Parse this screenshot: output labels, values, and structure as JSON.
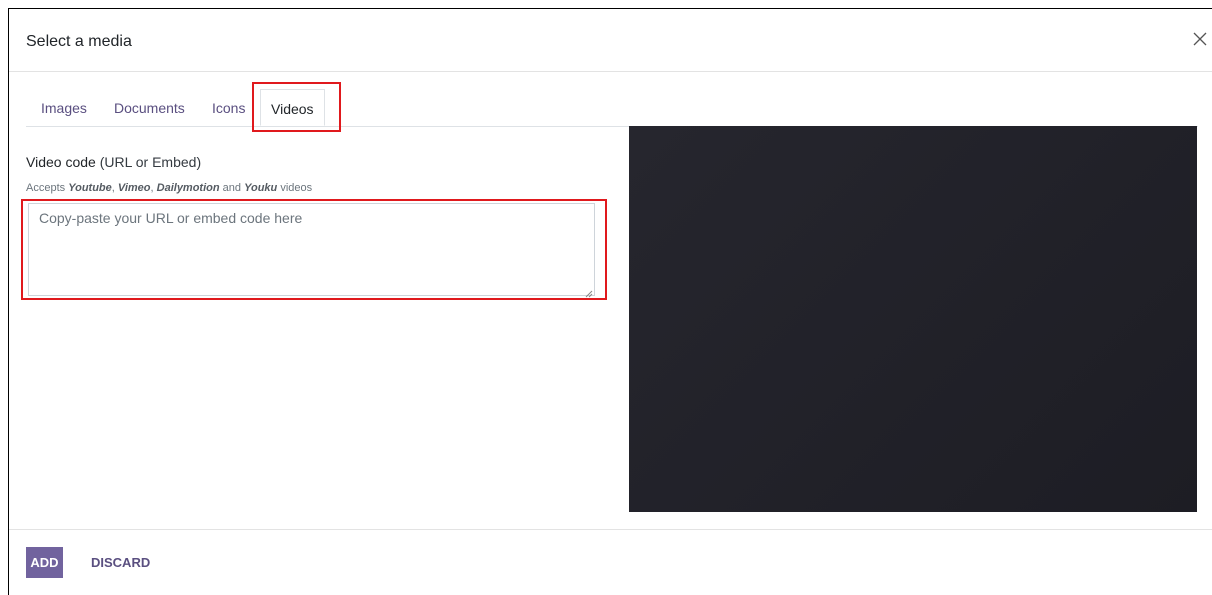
{
  "dialog": {
    "title": "Select a media",
    "close_icon": "close-icon"
  },
  "tabs": [
    {
      "label": "Images",
      "active": false
    },
    {
      "label": "Documents",
      "active": false
    },
    {
      "label": "Icons",
      "active": false
    },
    {
      "label": "Videos",
      "active": true
    }
  ],
  "video_form": {
    "label_main": "Video code",
    "label_sub": "(URL or Embed)",
    "help_prefix": "Accepts ",
    "help_sources": [
      "Youtube",
      "Vimeo",
      "Dailymotion",
      "Youku"
    ],
    "help_sep1": ", ",
    "help_sep2": ", ",
    "help_and": " and ",
    "help_suffix": " videos",
    "value": "",
    "placeholder": "Copy-paste your URL or embed code here"
  },
  "footer": {
    "add_label": "ADD",
    "discard_label": "DISCARD"
  },
  "colors": {
    "accent": "#71639e",
    "annotation": "#e0191d",
    "preview_bg": "#22222a"
  }
}
